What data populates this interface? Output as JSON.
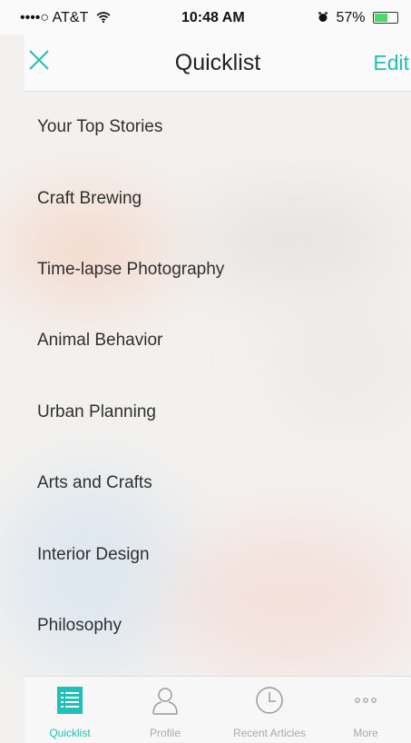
{
  "colors": {
    "accent": "#20c0b4",
    "battery_fill": "#4cd964"
  },
  "statusbar": {
    "carrier": "••••○ AT&T",
    "time": "10:48 AM",
    "battery_percent": "57%",
    "battery_level": 0.57
  },
  "navbar": {
    "close_icon": "close-icon",
    "title": "Quicklist",
    "edit_label": "Edit"
  },
  "list": {
    "items": [
      {
        "label": "Your Top Stories"
      },
      {
        "label": "Craft Brewing"
      },
      {
        "label": "Time-lapse Photography"
      },
      {
        "label": "Animal Behavior"
      },
      {
        "label": "Urban Planning"
      },
      {
        "label": "Arts and Crafts"
      },
      {
        "label": "Interior Design"
      },
      {
        "label": "Philosophy"
      }
    ]
  },
  "tabbar": {
    "tabs": [
      {
        "label": "Quicklist",
        "icon": "list-icon",
        "active": true
      },
      {
        "label": "Profile",
        "icon": "person-icon",
        "active": false
      },
      {
        "label": "Recent Articles",
        "icon": "clock-icon",
        "active": false
      },
      {
        "label": "More",
        "icon": "more-icon",
        "active": false
      }
    ]
  }
}
